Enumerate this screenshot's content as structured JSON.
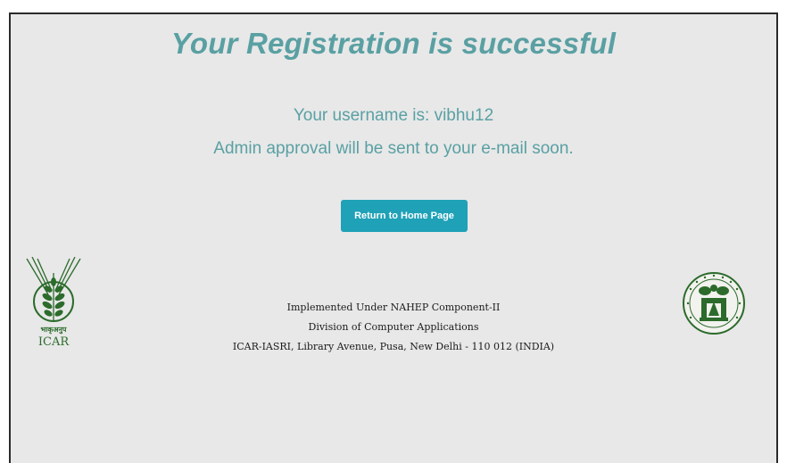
{
  "header": {
    "title": "Your Registration is successful"
  },
  "message": {
    "username_line": "Your username is: vibhu12",
    "approval_line": "Admin approval will be sent to your e-mail soon."
  },
  "actions": {
    "home_button_label": "Return to Home Page"
  },
  "footer": {
    "line1": "Implemented Under NAHEP Component-II",
    "line2": "Division of Computer Applications",
    "line3": "ICAR-IASRI, Library Avenue, Pusa, New Delhi - 110 012 (INDIA)"
  },
  "logos": {
    "left": {
      "script_text": "भाकृअनुप",
      "text": "ICAR",
      "icon": "icar-wheat-logo"
    },
    "right": {
      "icon": "iasri-emblem-logo"
    }
  },
  "colors": {
    "accent_text": "#5aa0a3",
    "button_bg": "#1fa1b7",
    "page_bg": "#e8e8e8",
    "logo_green": "#2c6b2c"
  }
}
